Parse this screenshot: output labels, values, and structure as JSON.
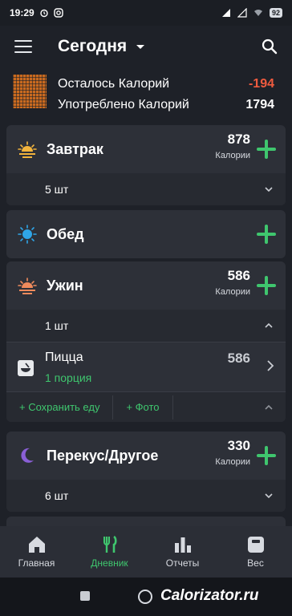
{
  "status_bar": {
    "time": "19:29",
    "battery": "92"
  },
  "app_bar": {
    "title": "Сегодня"
  },
  "summary": {
    "remaining_label": "Осталось Калорий",
    "remaining_value": "-194",
    "consumed_label": "Употреблено Калорий",
    "consumed_value": "1794"
  },
  "meals": {
    "breakfast": {
      "name": "Завтрак",
      "kcal": "878",
      "unit": "Калории",
      "count": "5 шт"
    },
    "lunch": {
      "name": "Обед"
    },
    "dinner": {
      "name": "Ужин",
      "kcal": "586",
      "unit": "Калории",
      "count": "1 шт",
      "food": {
        "name": "Пицца",
        "portion": "1 порция",
        "kcal": "586"
      },
      "actions": {
        "save": "+ Сохранить еду",
        "photo": "+ Фото"
      }
    },
    "snack": {
      "name": "Перекус/Другое",
      "kcal": "330",
      "unit": "Калории",
      "count": "6 шт"
    }
  },
  "bottom_nav": [
    {
      "label": "Главная",
      "icon": "home-icon"
    },
    {
      "label": "Дневник",
      "icon": "fork-knife-icon",
      "active": true
    },
    {
      "label": "Отчеты",
      "icon": "bar-chart-icon"
    },
    {
      "label": "Вес",
      "icon": "scale-icon"
    }
  ],
  "watermark": "Calorizator.ru",
  "colors": {
    "accent": "#3fc66e",
    "negative": "#ef5b3f",
    "background": "#1e2128",
    "card": "#2d3038"
  }
}
